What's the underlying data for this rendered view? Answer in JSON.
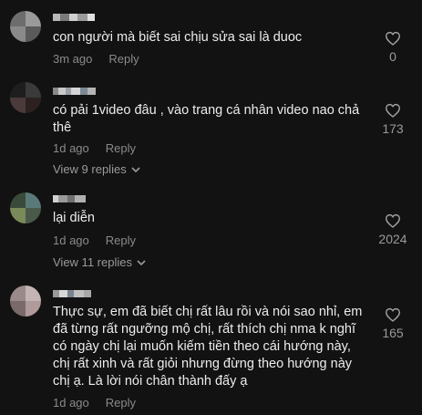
{
  "comments": [
    {
      "text": "con người mà biết sai chịu sửa sai là duoc",
      "time": "3m ago",
      "reply_label": "Reply",
      "likes": "0",
      "view_replies": ""
    },
    {
      "text": "có pải 1video đâu , vào trang cá nhân video nao chả thê",
      "time": "1d ago",
      "reply_label": "Reply",
      "likes": "173",
      "view_replies": "View 9 replies"
    },
    {
      "text": "lại diễn",
      "time": "1d ago",
      "reply_label": "Reply",
      "likes": "2024",
      "view_replies": "View 11 replies"
    },
    {
      "text": "Thực sự, em đã biết chị rất lâu rồi và nói sao nhỉ, em đã từng rất ngưỡng mộ chị, rất thích chị nma k nghĩ có ngày chị lại muốn kiếm tiền theo cái hướng này, chị rất xinh và rất giỏi nhưng đừng theo hướng này chị ạ. Là lời nói chân thành đấy ạ",
      "time": "1d ago",
      "reply_label": "Reply",
      "likes": "165",
      "view_replies": ""
    }
  ],
  "icons": {
    "like": "heart-outline-icon",
    "expand": "chevron-down-icon"
  },
  "colors": {
    "background": "#121212",
    "text": "#ececec",
    "muted": "#8a8a8a"
  }
}
